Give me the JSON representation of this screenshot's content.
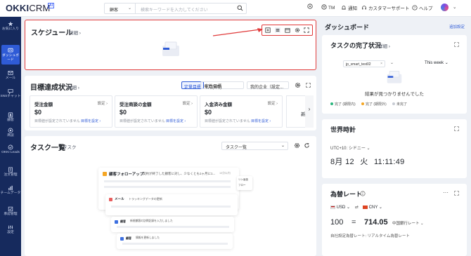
{
  "brand": {
    "name": "OKKI",
    "suffix": "CRM",
    "tag": "AI"
  },
  "search": {
    "scope": "顧客",
    "placeholder": "検索キーワードを入力してください"
  },
  "topnav": {
    "tm": "TM",
    "notify": "通知",
    "support": "カスタマーサポート",
    "help": "ヘルプ"
  },
  "sidebar": {
    "items": [
      {
        "label": "お気に入り",
        "icon": "star-icon"
      },
      {
        "label": "ダッシュボード",
        "icon": "dashboard-icon",
        "active": true
      },
      {
        "label": "メール",
        "icon": "mail-icon"
      },
      {
        "label": "SNSチャット",
        "icon": "chat-icon"
      },
      {
        "label": "顧客",
        "icon": "customer-icon"
      },
      {
        "label": "商談",
        "icon": "deal-icon"
      },
      {
        "label": "OKKI Leads",
        "icon": "leads-icon"
      },
      {
        "label": "注文管理",
        "icon": "order-icon"
      },
      {
        "label": "チームデータ",
        "icon": "team-data-icon"
      },
      {
        "label": "承認管理",
        "icon": "approval-icon"
      },
      {
        "label": "設定",
        "icon": "settings-icon"
      }
    ]
  },
  "schedule": {
    "title": "スケジュール",
    "detail": "詳細 ›"
  },
  "goals": {
    "title": "目標達成状況",
    "detail": "詳細 ›",
    "tab_def": "定量目標",
    "tab_qual": "定性目標",
    "period": "今月(8月)",
    "company": "我的企业（設定...",
    "metrics": [
      {
        "title": "受注金額",
        "setting": "設定 ›",
        "value": "$0",
        "note": "目標値が設定されていません",
        "link": "目標を設定 ›"
      },
      {
        "title": "受注商談の金額",
        "setting": "設定 ›",
        "value": "$0",
        "note": "目標値が設定されていません",
        "link": "目標を設定 ›"
      },
      {
        "title": "入金済み金額",
        "setting": "設定 ›",
        "value": "$0",
        "note": "目標値が設定されていません",
        "link": "目標を設定 ›"
      }
    ],
    "next_label": "新"
  },
  "tasklist": {
    "title": "タスク一覧",
    "subtitle": "タスク",
    "select": "タスク一覧",
    "illus_header": "顧客フォローアップ",
    "illus_header_desc": "契約が終了した顧客に対し、少なくとも1ヶ月に1...",
    "illus_badge": "10分以内",
    "illus_row1": "メール",
    "illus_row1_desc": "トラッキングデータの更新",
    "illus_row2": "顧客",
    "illus_row2_desc": "新規顧客の訪問記録を入力しました",
    "illus_row3": "顧客",
    "illus_row3_desc": "情報を更新しました",
    "illus_side": "リン返信",
    "illus_side2": "フロー"
  },
  "right": {
    "title": "ダッシュボード",
    "add": "追加設定",
    "task_status": {
      "title": "タスクの完了状況",
      "detail": "詳細 ›",
      "user_chip": "jp_smart_test02",
      "range": "This week",
      "empty": "結果が見つかりませんでした",
      "legend": [
        {
          "label": "完了 (期限内)",
          "color": "#2ab57d"
        },
        {
          "label": "完了 (期限外)",
          "color": "#f5a623"
        },
        {
          "label": "未完了",
          "color": "#c7cbd3"
        }
      ]
    },
    "clock": {
      "title": "世界時計",
      "zone": "UTC+10: シドニー",
      "date": "8月 12",
      "weekday": "火",
      "time": "11:11:49"
    },
    "fx": {
      "title": "為替レート",
      "from": "USD",
      "to": "CNY",
      "amount": "100",
      "eq": "=",
      "result": "714.05",
      "source": "中国銀行レート",
      "note": "自社設定為替レート: リアルタイム為替レート"
    }
  }
}
